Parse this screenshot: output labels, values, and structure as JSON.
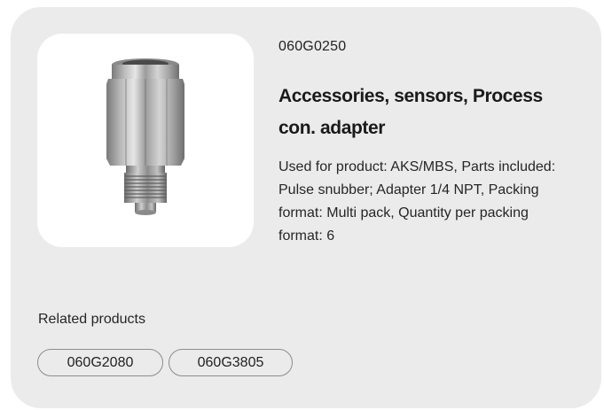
{
  "product": {
    "sku": "060G0250",
    "title": "Accessories, sensors, Process con. adapter",
    "description": "Used for product: AKS/MBS, Parts included: Pulse snubber; Adapter 1/4 NPT, Packing format: Multi pack, Quantity per packing format: 6",
    "image_icon": "adapter-fitting-icon"
  },
  "related": {
    "heading": "Related products",
    "items": [
      {
        "label": "060G2080"
      },
      {
        "label": "060G3805"
      }
    ]
  }
}
